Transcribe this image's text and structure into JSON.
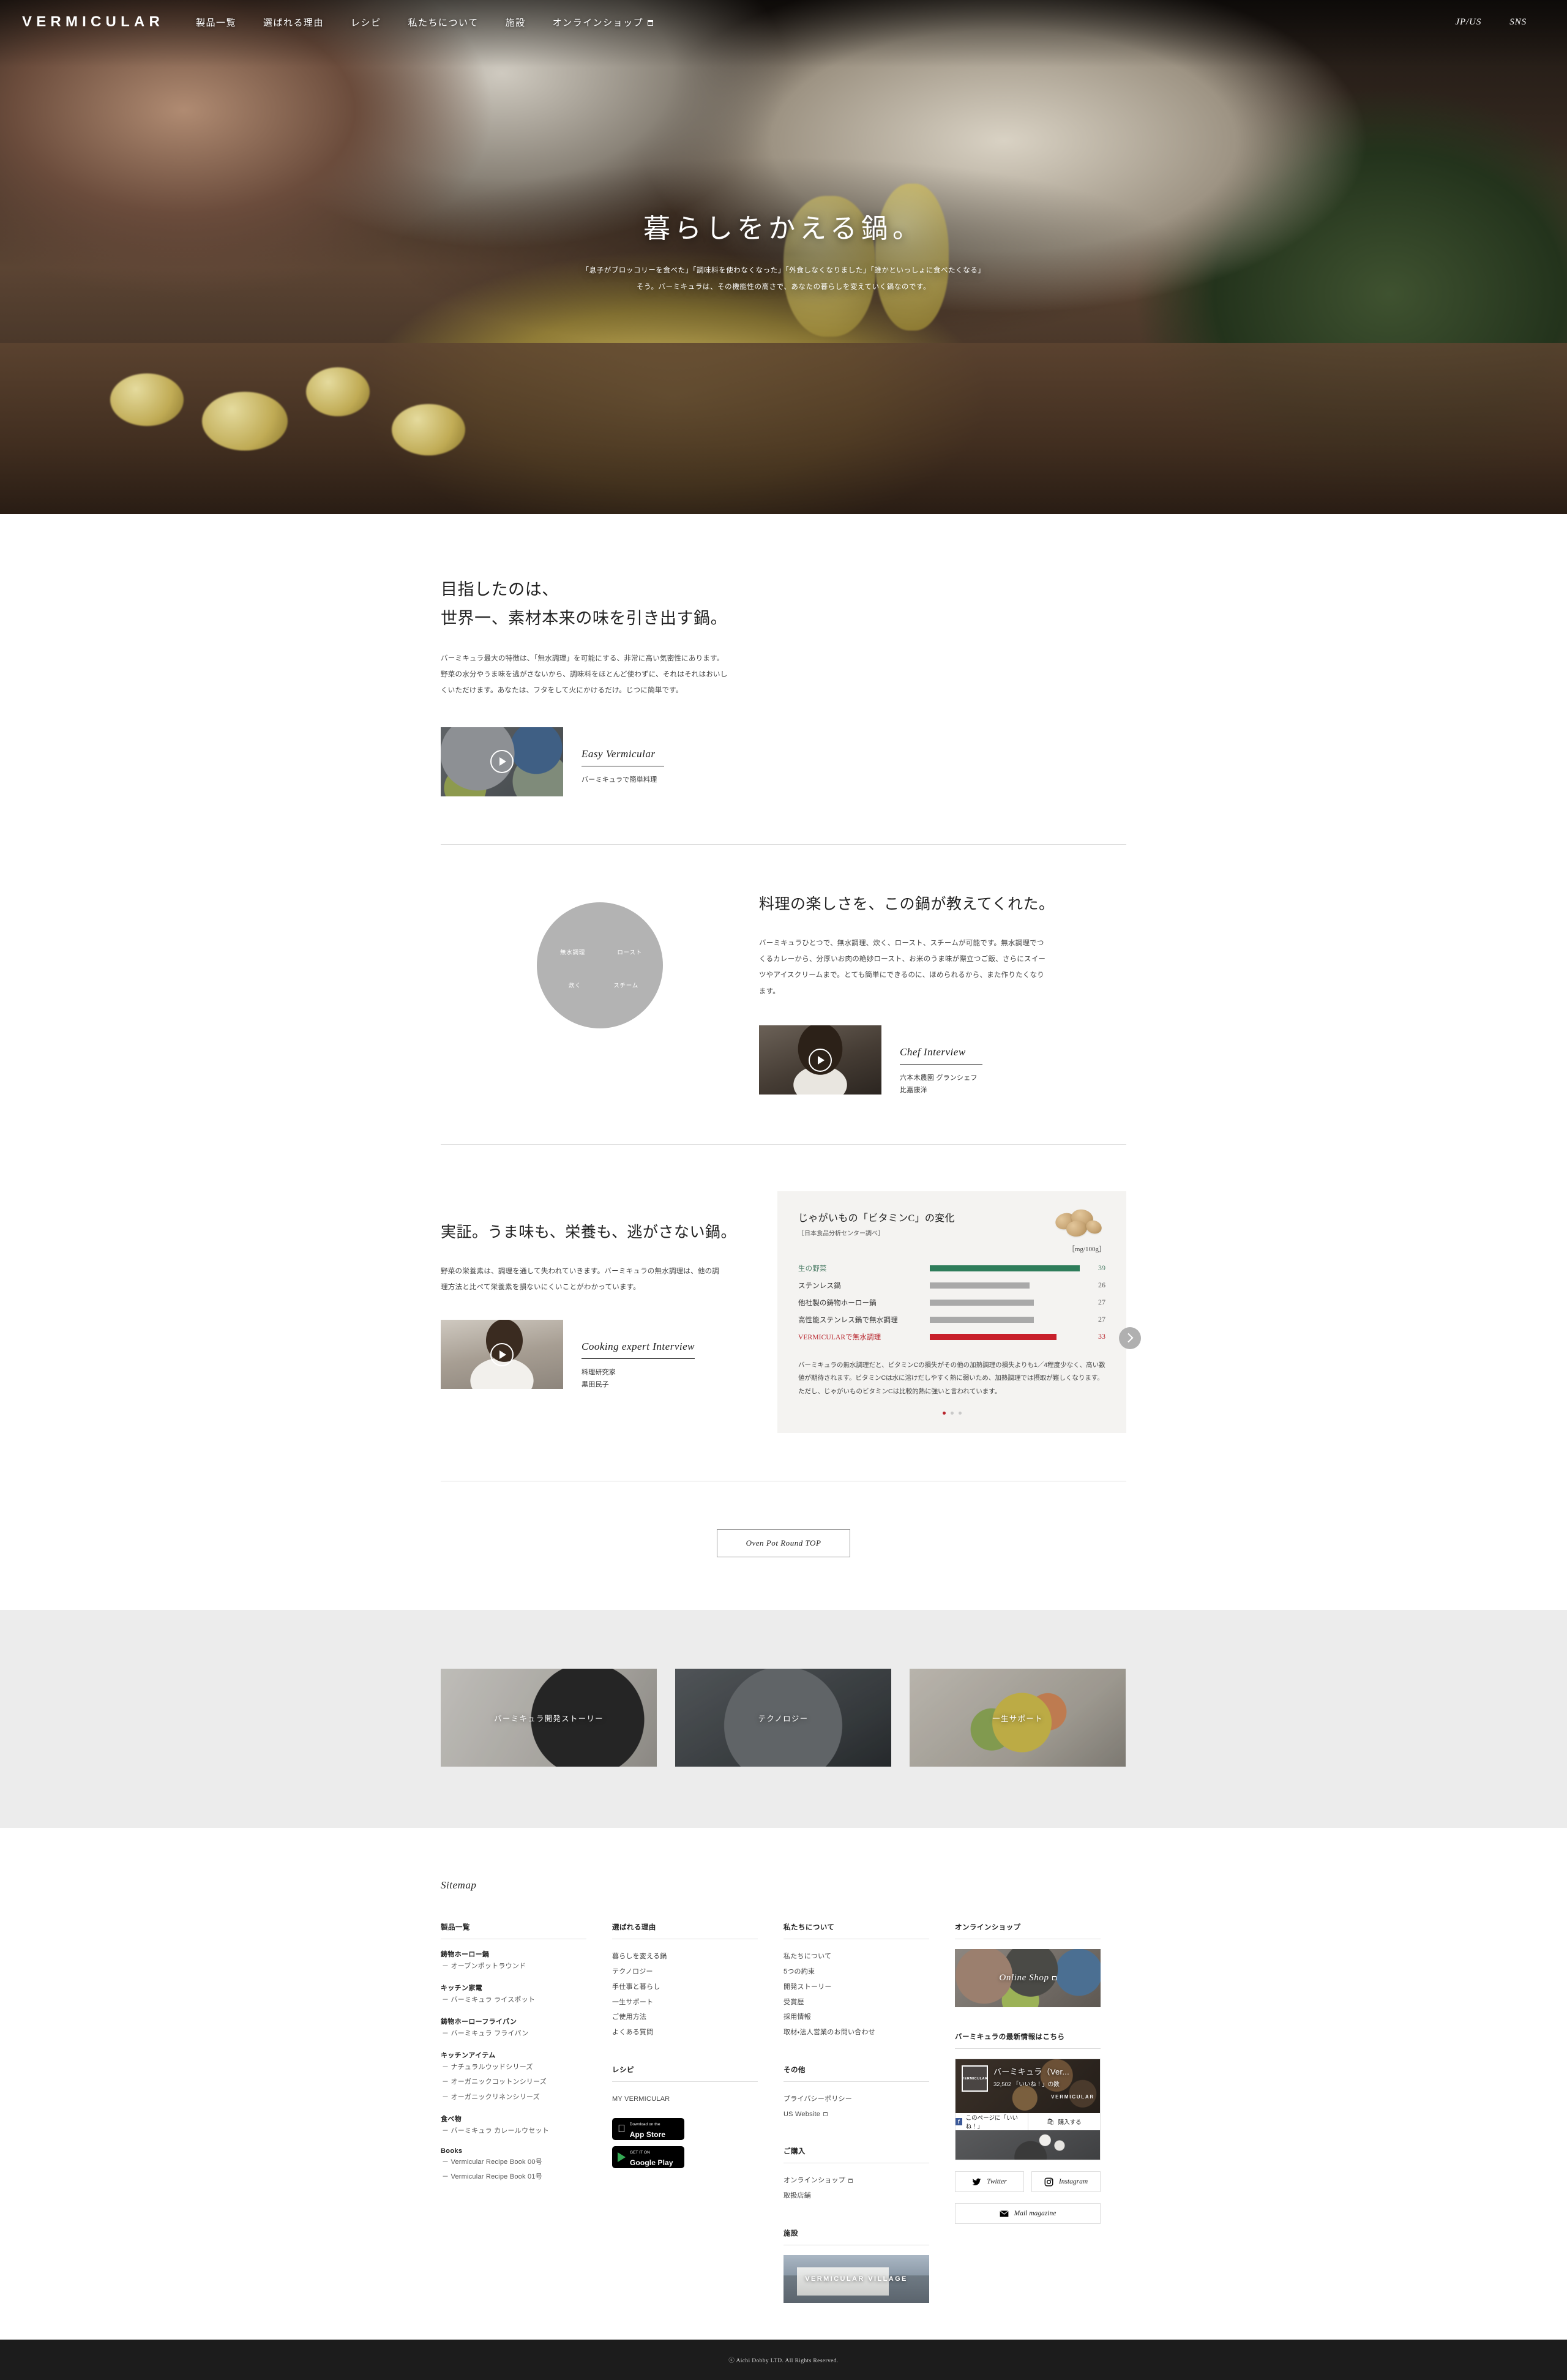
{
  "nav": {
    "brand": "VERMICULAR",
    "links": [
      {
        "label": "製品一覧",
        "external": false
      },
      {
        "label": "選ばれる理由",
        "external": false
      },
      {
        "label": "レシピ",
        "external": false
      },
      {
        "label": "私たちについて",
        "external": false
      },
      {
        "label": "施設",
        "external": false
      },
      {
        "label": "オンラインショップ",
        "external": true
      }
    ],
    "lang": "JP/US",
    "sns": "SNS"
  },
  "hero": {
    "title": "暮らしをかえる鍋。",
    "sub1": "「息子がブロッコリーを食べた」「調味料を使わなくなった」「外食しなくなりました」「誰かといっしょに食べたくなる」",
    "sub2": "そう。バーミキュラは、その機能性の高さで、あなたの暮らしを変えていく鍋なのです。"
  },
  "section1": {
    "title_line1": "目指したのは、",
    "title_line2": "世界一、素材本来の味を引き出す鍋。",
    "body": "バーミキュラ最大の特徴は、「無水調理」を可能にする、非常に高い気密性にあります。野菜の水分やうま味を逃がさないから、調味料をほとんど使わずに、それはそれはおいしくいただけます。あなたは、フタをして火にかけるだけ。じつに簡単です。",
    "video": {
      "title": "Easy Vermicular",
      "caption": "バーミキュラで簡単料理",
      "play_icon": "play-icon"
    }
  },
  "section2": {
    "circle_labels": [
      "無水調理",
      "ロースト",
      "炊く",
      "スチーム"
    ],
    "title": "料理の楽しさを、この鍋が教えてくれた。",
    "body": "バーミキュラひとつで、無水調理、炊く、ロースト、スチームが可能です。無水調理でつくるカレーから、分厚いお肉の絶妙ロースト、お米のうま味が際立つご飯、さらにスイーツやアイスクリームまで。とても簡単にできるのに、ほめられるから、また作りたくなります。",
    "video": {
      "title": "Chef Interview",
      "caption_line1": "六本木農園 グランシェフ",
      "caption_line2": "比嘉康洋",
      "play_icon": "play-icon"
    }
  },
  "section3": {
    "title": "実証。うま味も、栄養も、逃がさない鍋。",
    "body": "野菜の栄養素は、調理を通して失われていきます。バーミキュラの無水調理は、他の調理方法と比べて栄養素を損ないにくいことがわかっています。",
    "video": {
      "title": "Cooking expert Interview",
      "caption_line1": "料理研究家",
      "caption_line2": "黒田民子",
      "play_icon": "play-icon"
    },
    "note": "バーミキュラの無水調理だと、ビタミンCの損失がその他の加熱調理の損失よりも1／4程度少なく、高い数値が期待されます。ビタミンCは水に溶けだしやすく熱に弱いため、加熱調理では摂取が難しくなります。ただし、じゃがいものビタミンCは比較的熱に強いと言われています。",
    "next_icon": "chevron-right-icon"
  },
  "chart_data": {
    "type": "bar",
    "title": "じゃがいもの「ビタミンC」の変化",
    "subtitle": "［日本食品分析センター調べ］",
    "unit": "［mg/100g］",
    "orientation": "horizontal",
    "categories": [
      "生の野菜",
      "ステンレス鍋",
      "他社製の鋳物ホーロー鍋",
      "高性能ステンレス鍋で無水調理",
      "VERMICULARで無水調理"
    ],
    "values": [
      39,
      26,
      27,
      27,
      33
    ],
    "colors": [
      "#2e7d5b",
      "#a9a9a9",
      "#a9a9a9",
      "#a9a9a9",
      "#c8202b"
    ],
    "xlabel": "",
    "ylabel": "",
    "xlim": [
      0,
      39
    ],
    "grid": false,
    "legend": false,
    "pagination_dots": 3,
    "pagination_active": 0
  },
  "cta": {
    "label": "Oven Pot Round TOP"
  },
  "banner_cards": [
    {
      "label": "バーミキュラ開発ストーリー"
    },
    {
      "label": "テクノロジー"
    },
    {
      "label": "一生サポート"
    }
  ],
  "footer": {
    "sitemap_title": "Sitemap",
    "col1": {
      "head": "製品一覧",
      "groups": [
        {
          "title": "鋳物ホーロー鍋",
          "items": [
            "－ オーブンポットラウンド"
          ]
        },
        {
          "title": "キッチン家電",
          "items": [
            "－ バーミキュラ ライスポット"
          ]
        },
        {
          "title": "鋳物ホーローフライパン",
          "items": [
            "－ バーミキュラ フライパン"
          ]
        },
        {
          "title": "キッチンアイテム",
          "items": [
            "－ ナチュラルウッドシリーズ",
            "－ オーガニックコットンシリーズ",
            "－ オーガニックリネンシリーズ"
          ]
        },
        {
          "title": "食べ物",
          "items": [
            "－ バーミキュラ カレールウセット"
          ]
        },
        {
          "title": "Books",
          "items": [
            "－ Vermicular Recipe Book 00号",
            "－ Vermicular Recipe Book 01号"
          ]
        }
      ]
    },
    "col2": {
      "head": "選ばれる理由",
      "items": [
        "暮らしを変える鍋",
        "テクノロジー",
        "手仕事と暮らし",
        "一生サポート",
        "ご使用方法",
        "よくある質問"
      ],
      "head2": "レシピ",
      "items2": [
        "MY VERMICULAR"
      ],
      "badges": [
        {
          "small": "Download on the",
          "big": "App Store",
          "icon": "apple-icon"
        },
        {
          "small": "GET IT ON",
          "big": "Google Play",
          "icon": "google-play-icon"
        }
      ]
    },
    "col3": {
      "head": "私たちについて",
      "items": [
        "私たちについて",
        "5つの約束",
        "開発ストーリー",
        "受賞歴",
        "採用情報",
        "取材・法人営業のお問い合わせ"
      ],
      "head2": "その他",
      "items2": [
        "プライバシーポリシー",
        "US Website"
      ],
      "head3": "ご購入",
      "items3": [
        "オンラインショップ",
        "取扱店舗"
      ],
      "head4": "施設",
      "village_label": "VERMICULAR VILLAGE"
    },
    "col4": {
      "head": "オンラインショップ",
      "shop_label": "Online Shop",
      "head2": "バーミキュラの最新情報はこちら",
      "fb": {
        "avatar_text": "VERMICULAR",
        "page_name": "バーミキュラ（Ver...",
        "likes": "32,502 「いいね！」の数",
        "watermark": "VERMICULAR",
        "btn_like": "このページに「いいね！」",
        "btn_buy": "購入する"
      },
      "sns": [
        {
          "label": "Twitter",
          "icon": "twitter-icon"
        },
        {
          "label": "Instagram",
          "icon": "instagram-icon"
        },
        {
          "label": "Mail magazine",
          "icon": "mail-icon"
        }
      ]
    }
  },
  "copyright": "ⓒ Aichi Dobby LTD. All Rights Reserved."
}
